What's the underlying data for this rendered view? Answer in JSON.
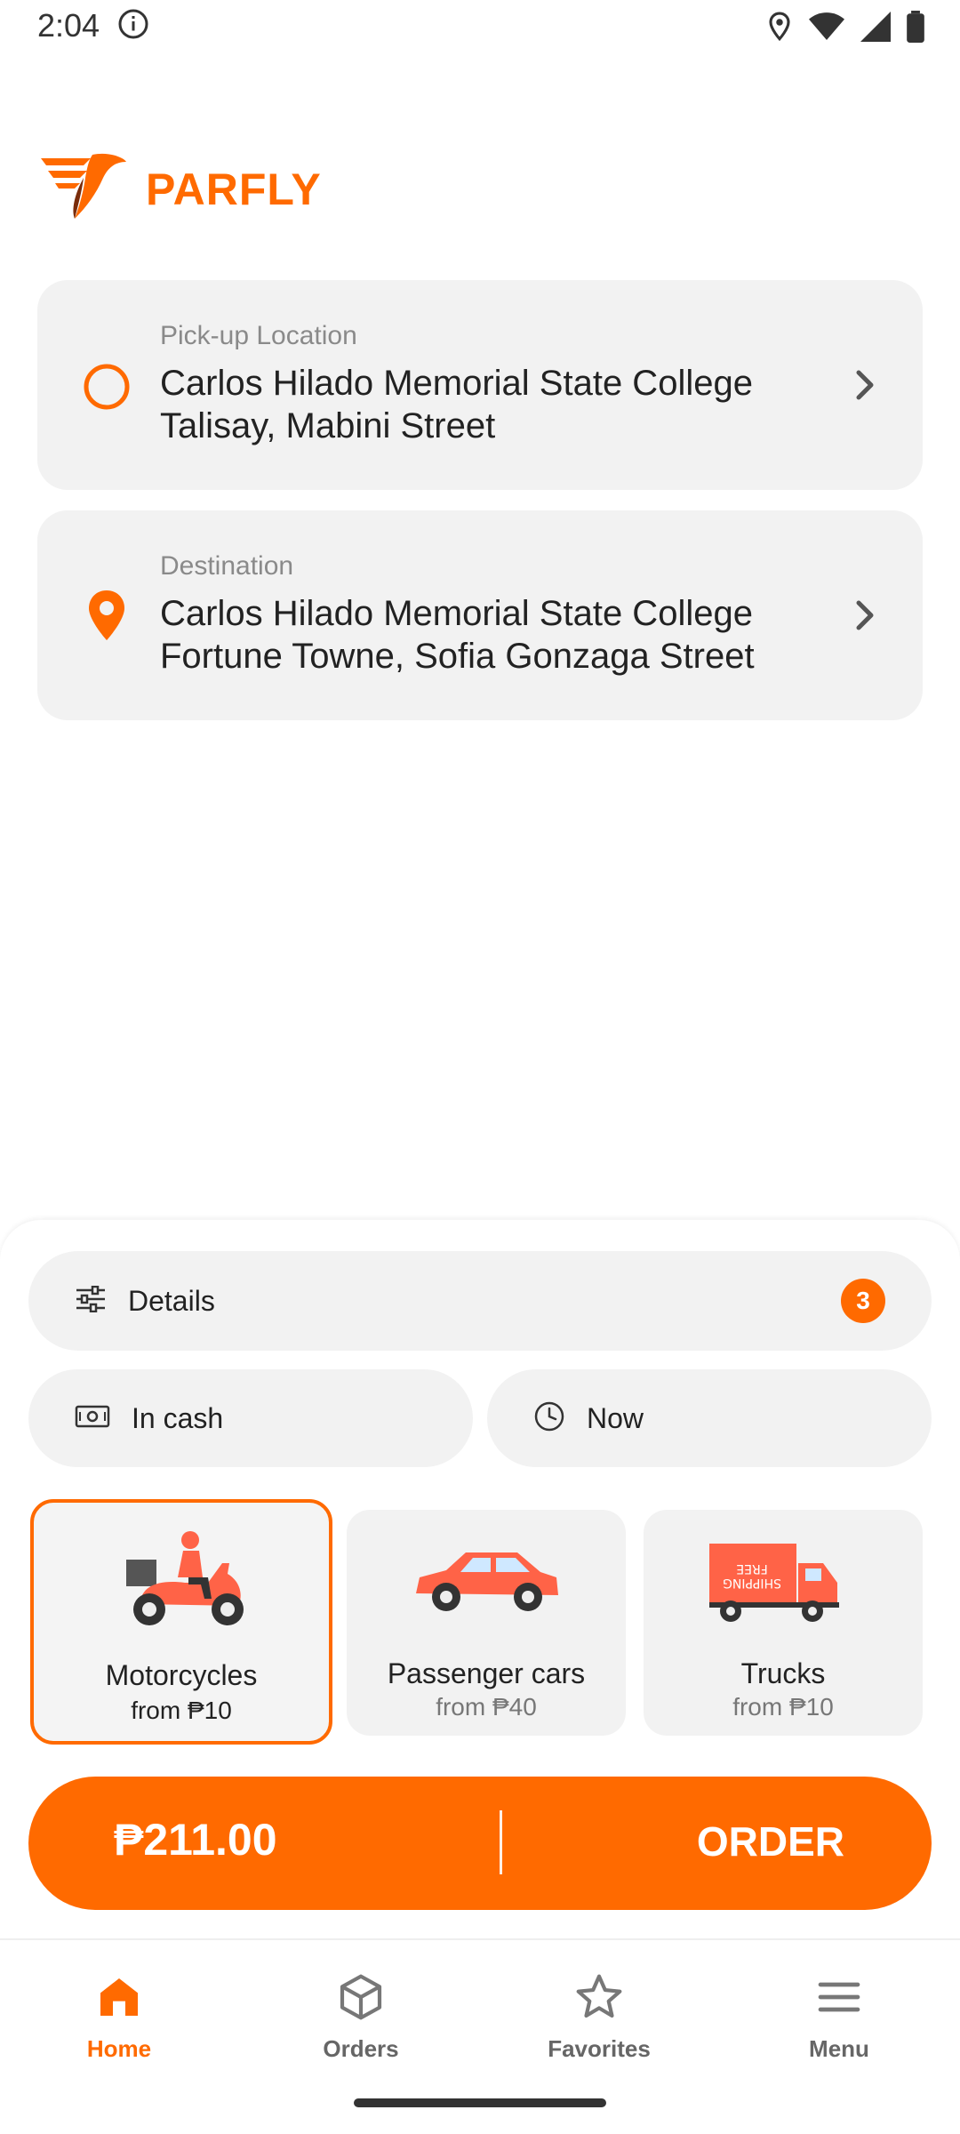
{
  "status_bar": {
    "time": "2:04"
  },
  "brand": {
    "name": "PARFLY",
    "accent_color": "#ff6a00"
  },
  "pickup": {
    "label": "Pick-up Location",
    "address": "Carlos Hilado Memorial State College Talisay, Mabini Street"
  },
  "destination": {
    "label": "Destination",
    "address": "Carlos Hilado Memorial State College Fortune Towne, Sofia Gonzaga Street"
  },
  "details": {
    "label": "Details",
    "badge_count": "3"
  },
  "payment": {
    "label": "In cash"
  },
  "schedule": {
    "label": "Now"
  },
  "vehicles": [
    {
      "title": "Motorcycles",
      "price": "from ₱10",
      "icon": "motorcycle-icon",
      "selected": true
    },
    {
      "title": "Passenger cars",
      "price": "from ₱40",
      "icon": "car-icon",
      "selected": false
    },
    {
      "title": "Trucks",
      "price": "from ₱10",
      "icon": "truck-icon",
      "selected": false
    }
  ],
  "order": {
    "price": "₱211.00",
    "button_label": "ORDER"
  },
  "nav": {
    "items": [
      {
        "label": "Home",
        "icon": "home-icon",
        "active": true
      },
      {
        "label": "Orders",
        "icon": "box-icon",
        "active": false
      },
      {
        "label": "Favorites",
        "icon": "star-icon",
        "active": false
      },
      {
        "label": "Menu",
        "icon": "menu-icon",
        "active": false
      }
    ]
  }
}
